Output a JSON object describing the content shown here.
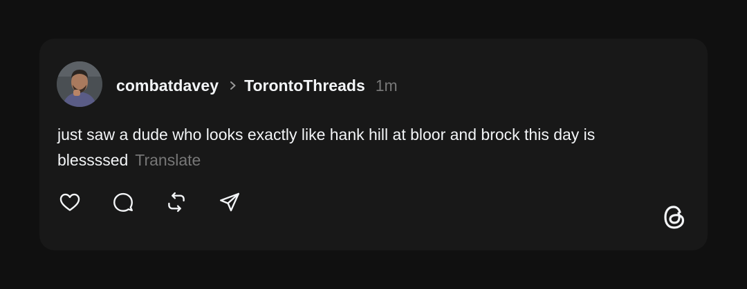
{
  "post": {
    "username": "combatdavey",
    "community": "TorontoThreads",
    "time": "1m",
    "text": "just saw a dude who looks exactly like hank hill at bloor and brock this day is blessssed",
    "translate_label": "Translate"
  },
  "actions": {
    "like_icon": "heart-icon",
    "reply_icon": "speech-bubble-icon",
    "repost_icon": "repost-icon",
    "share_icon": "paper-plane-icon"
  },
  "brand": {
    "logo_icon": "threads-logo-icon"
  },
  "colors": {
    "background": "#101010",
    "card": "#181818",
    "text_primary": "#f3f5f7",
    "text_secondary": "#777777"
  }
}
